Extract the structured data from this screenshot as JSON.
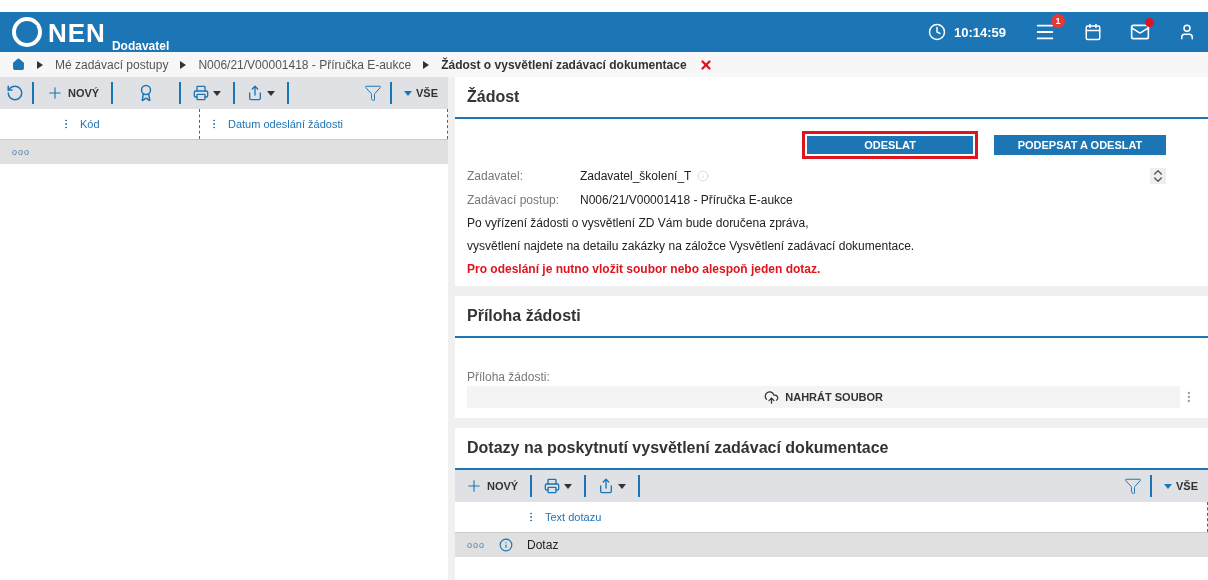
{
  "header": {
    "logo": "NEN",
    "subtitle": "Dodavatel",
    "time": "10:14:59",
    "notification_count": "1",
    "mail_unread": true
  },
  "breadcrumb": [
    {
      "label": "Mé zadávací postupy",
      "selected": false
    },
    {
      "label": "N006/21/V00001418 - Příručka E-aukce",
      "selected": false
    },
    {
      "label": "Žádost o vysvětlení zadávací dokumentace",
      "selected": true
    }
  ],
  "left_panel": {
    "toolbar": {
      "new_label": "NOVÝ",
      "filter_label": "VŠE"
    },
    "columns": [
      "Kód",
      "Datum odeslání žádosti"
    ],
    "row_menu": "ooo"
  },
  "request": {
    "title": "Žádost",
    "buttons": [
      {
        "label": "ODESLAT",
        "highlighted": true
      },
      {
        "label": "PODEPSAT A ODESLAT",
        "highlighted": false
      }
    ],
    "fields": [
      {
        "label": "Zadavatel:",
        "value": "Zadavatel_školení_T",
        "info": true
      },
      {
        "label": "Zadávací postup:",
        "value": "N006/21/V00001418 - Příručka E-aukce",
        "info": false
      }
    ],
    "notes": [
      {
        "text": "Po vyřízení žádosti o vysvětlení ZD Vám bude doručena zpráva,",
        "warning": false
      },
      {
        "text": "vysvětlení najdete na detailu zakázky na záložce Vysvětlení zadávací dokumentace.",
        "warning": false
      },
      {
        "text": "Pro odeslání je nutno vložit soubor nebo alespoň jeden dotaz.",
        "warning": true
      }
    ]
  },
  "attachment": {
    "title": "Příloha žádosti",
    "label": "Příloha žádosti:",
    "upload_button": "NAHRÁT SOUBOR"
  },
  "questions": {
    "title": "Dotazy na poskytnutí vysvětlení zadávací dokumentace",
    "toolbar": {
      "new_label": "NOVÝ",
      "filter_label": "VŠE"
    },
    "columns": [
      "Text dotazu"
    ],
    "rows": [
      {
        "row_menu": "ooo",
        "text": "Dotaz"
      }
    ]
  }
}
